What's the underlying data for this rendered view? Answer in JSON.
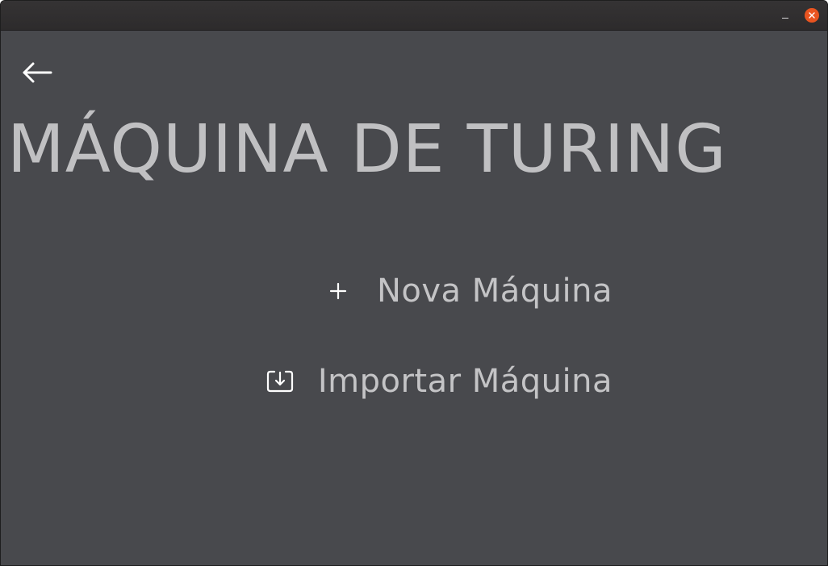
{
  "window": {
    "controls": {
      "minimize_icon": "minimize-icon",
      "close_icon": "close-icon",
      "close_color": "#e95420"
    }
  },
  "nav": {
    "back_icon": "arrow-left-icon"
  },
  "page": {
    "title": "MÁQUINA DE TURING"
  },
  "menu": {
    "items": [
      {
        "label": "Nova Máquina",
        "icon": "plus-icon"
      },
      {
        "label": "Importar Máquina",
        "icon": "import-icon"
      }
    ]
  },
  "colors": {
    "background": "#48494d",
    "titlebar": "#2f2d2e",
    "text": "#c0c0c2",
    "icon": "#ffffff"
  }
}
